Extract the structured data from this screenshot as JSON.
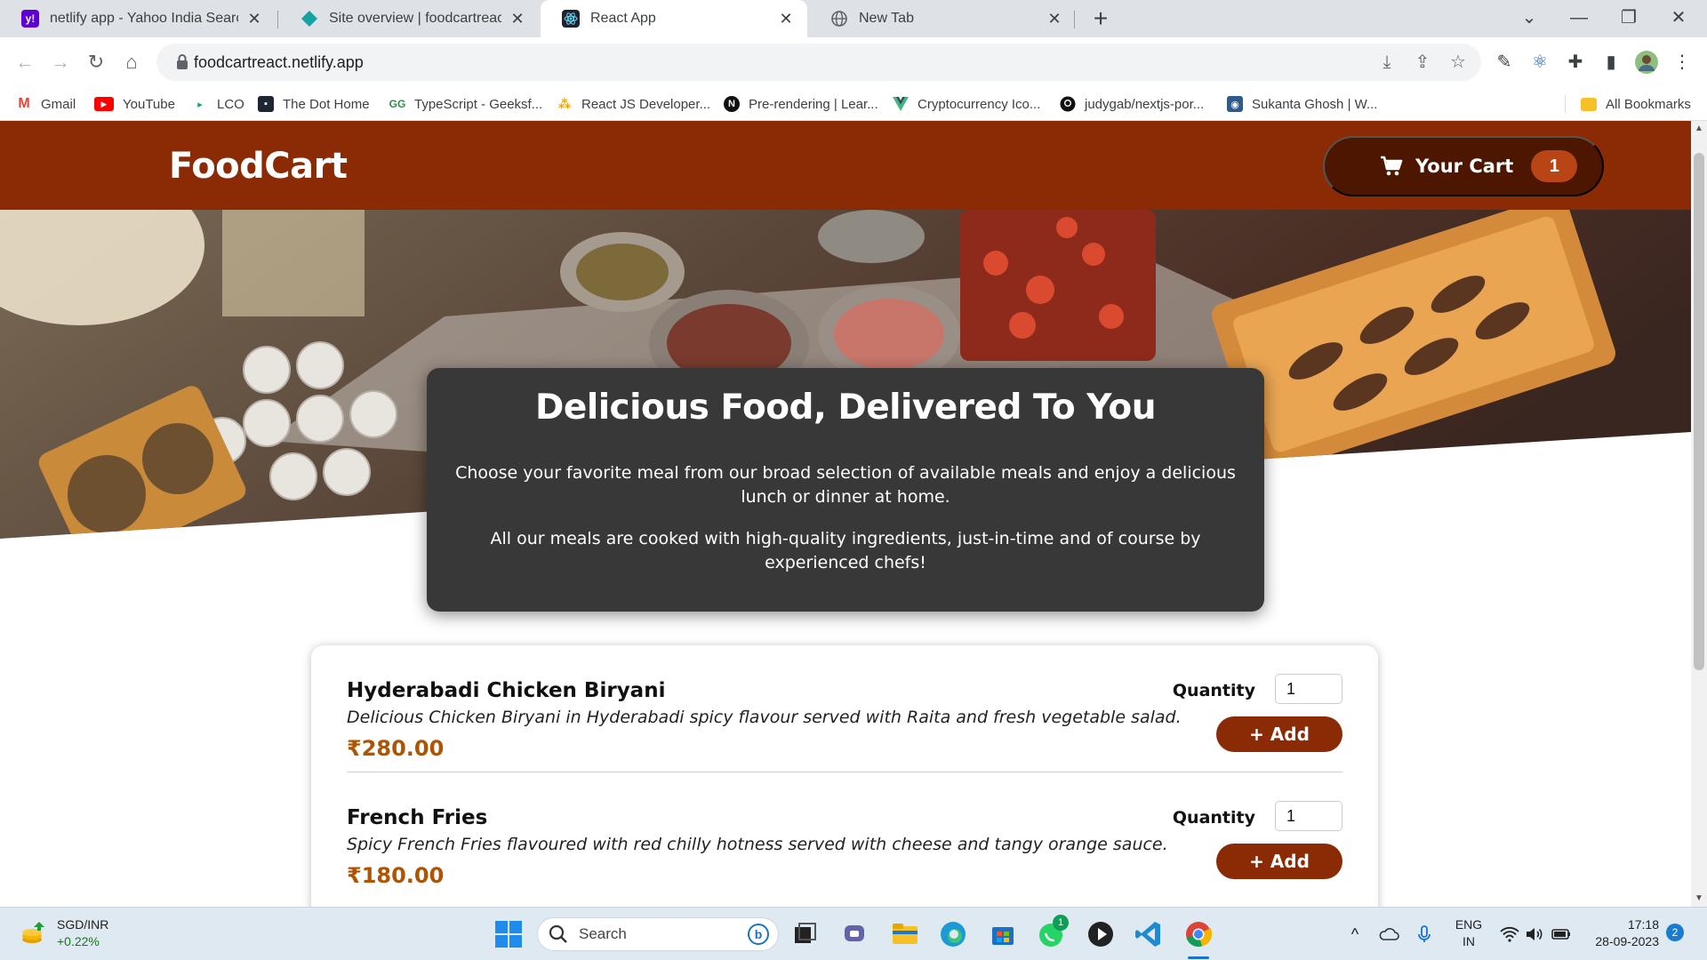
{
  "browser": {
    "tabs": [
      {
        "title": "netlify app - Yahoo India Search",
        "icon": "yahoo-icon"
      },
      {
        "title": "Site overview | foodcartreact | N",
        "icon": "netlify-icon"
      },
      {
        "title": "React App",
        "icon": "react-icon",
        "active": true
      },
      {
        "title": "New Tab",
        "icon": "globe-icon"
      }
    ],
    "url": "foodcartreact.netlify.app",
    "bookmarks": [
      {
        "label": "Gmail",
        "icon": "gmail-icon"
      },
      {
        "label": "YouTube",
        "icon": "youtube-icon"
      },
      {
        "label": "LCO",
        "icon": "lco-icon"
      },
      {
        "label": "The Dot Home",
        "icon": "dot-home-icon"
      },
      {
        "label": "TypeScript - Geeksf...",
        "icon": "geeksforgeeks-icon"
      },
      {
        "label": "React JS Developer...",
        "icon": "react-dev-icon"
      },
      {
        "label": "Pre-rendering | Lear...",
        "icon": "nextjs-icon"
      },
      {
        "label": "Cryptocurrency Ico...",
        "icon": "vue-icon"
      },
      {
        "label": "judygab/nextjs-por...",
        "icon": "github-icon"
      },
      {
        "label": "Sukanta Ghosh | W...",
        "icon": "profile-icon"
      }
    ],
    "all_bookmarks": "All Bookmarks"
  },
  "app": {
    "brand": "FoodCart",
    "cart_label": "Your Cart",
    "cart_count": "1",
    "summary": {
      "title": "Delicious Food, Delivered To You",
      "p1": "Choose your favorite meal from our broad selection of available meals and enjoy a delicious lunch or dinner at home.",
      "p2": "All our meals are cooked with high-quality ingredients, just-in-time and of course by experienced chefs!"
    },
    "meals": [
      {
        "name": "Hyderabadi Chicken Biryani",
        "description": "Delicious Chicken Biryani in Hyderabadi spicy flavour served with Raita and fresh vegetable salad.",
        "price": "₹280.00",
        "quantity_label": "Quantity",
        "quantity": "1",
        "add_label": "+ Add"
      },
      {
        "name": "French Fries",
        "description": "Spicy French Fries flavoured with red chilly hotness served with cheese and tangy orange sauce.",
        "price": "₹180.00",
        "quantity_label": "Quantity",
        "quantity": "1",
        "add_label": "+ Add"
      }
    ],
    "colors": {
      "header": "#8a2b06",
      "cart_button": "#4d1601",
      "badge": "#b94517",
      "price": "#ad5502",
      "summary_bg": "#383838"
    }
  },
  "taskbar": {
    "widget_title": "SGD/INR",
    "widget_change": "+0.22%",
    "search_placeholder": "Search",
    "lang_line1": "ENG",
    "lang_line2": "IN",
    "time": "17:18",
    "date": "28-09-2023",
    "notifications": "2",
    "whatsapp_badge": "1"
  }
}
